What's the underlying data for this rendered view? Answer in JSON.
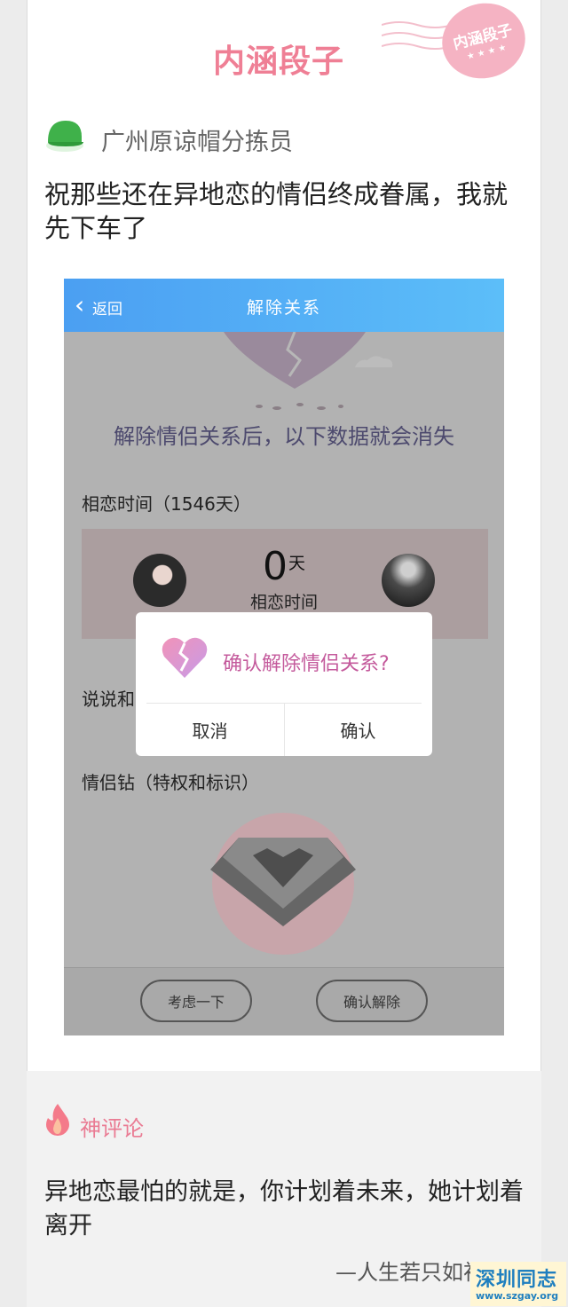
{
  "header": {
    "brand": "内涵段子",
    "stamp_text": "内涵段子",
    "stamp_dots": "★ ★ ★ ★"
  },
  "post": {
    "author": "广州原谅帽分拣员",
    "avatar_icon": "green-hat-icon",
    "title": "祝那些还在异地恋的情侣终成眷属，我就先下车了"
  },
  "screenshot": {
    "nav": {
      "back_label": "返回",
      "title": "解除关系"
    },
    "notice": "解除情侣关系后，以下数据就会消失",
    "love_time_label": "相恋时间（1546天）",
    "days_value": "0",
    "days_unit": "天",
    "days_caption": "相恋时间",
    "feed_label": "说说和",
    "diamond_label": "情侣钻（特权和标识）",
    "dialog": {
      "message": "确认解除情侣关系?",
      "cancel": "取消",
      "confirm": "确认"
    },
    "buttons": {
      "reconsider": "考虑一下",
      "confirm_release": "确认解除"
    }
  },
  "comments": {
    "title": "神评论",
    "text": "异地恋最怕的就是，你计划着未来，她计划着离开",
    "author": "—人生若只如初见"
  },
  "watermark": {
    "title": "深圳同志",
    "url": "www.szgay.org"
  },
  "colors": {
    "brand_pink": "#ef7f95",
    "nav_blue": "#4b9ff2",
    "dialog_text": "#c45a9c",
    "watermark_blue": "#1f7fbf"
  }
}
